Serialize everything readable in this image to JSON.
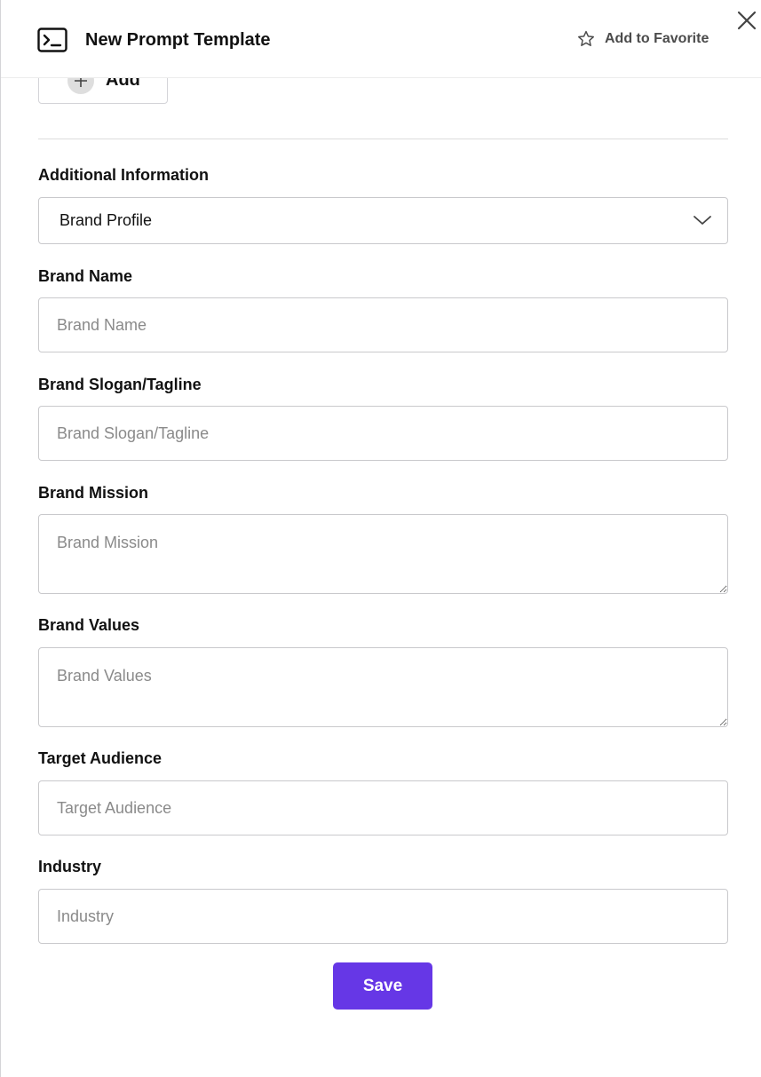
{
  "header": {
    "title": "New Prompt Template",
    "favorite_label": "Add to Favorite"
  },
  "add_button": {
    "label": "Add"
  },
  "additional_info": {
    "label": "Additional Information",
    "selected": "Brand Profile"
  },
  "fields": {
    "brand_name": {
      "label": "Brand Name",
      "placeholder": "Brand Name",
      "value": ""
    },
    "brand_slogan": {
      "label": "Brand Slogan/Tagline",
      "placeholder": "Brand Slogan/Tagline",
      "value": ""
    },
    "brand_mission": {
      "label": "Brand Mission",
      "placeholder": "Brand Mission",
      "value": ""
    },
    "brand_values": {
      "label": "Brand Values",
      "placeholder": "Brand Values",
      "value": ""
    },
    "target_audience": {
      "label": "Target Audience",
      "placeholder": "Target Audience",
      "value": ""
    },
    "industry": {
      "label": "Industry",
      "placeholder": "Industry",
      "value": ""
    }
  },
  "save_button": {
    "label": "Save"
  },
  "colors": {
    "accent": "#6637e6",
    "border": "#c9c9cc",
    "placeholder": "#8a8a8a"
  },
  "icons": {
    "header": "terminal-icon",
    "favorite": "star-icon",
    "close": "close-icon",
    "add": "plus-icon",
    "select": "chevron-down-icon",
    "textarea_resize": "resize-handle-icon"
  }
}
